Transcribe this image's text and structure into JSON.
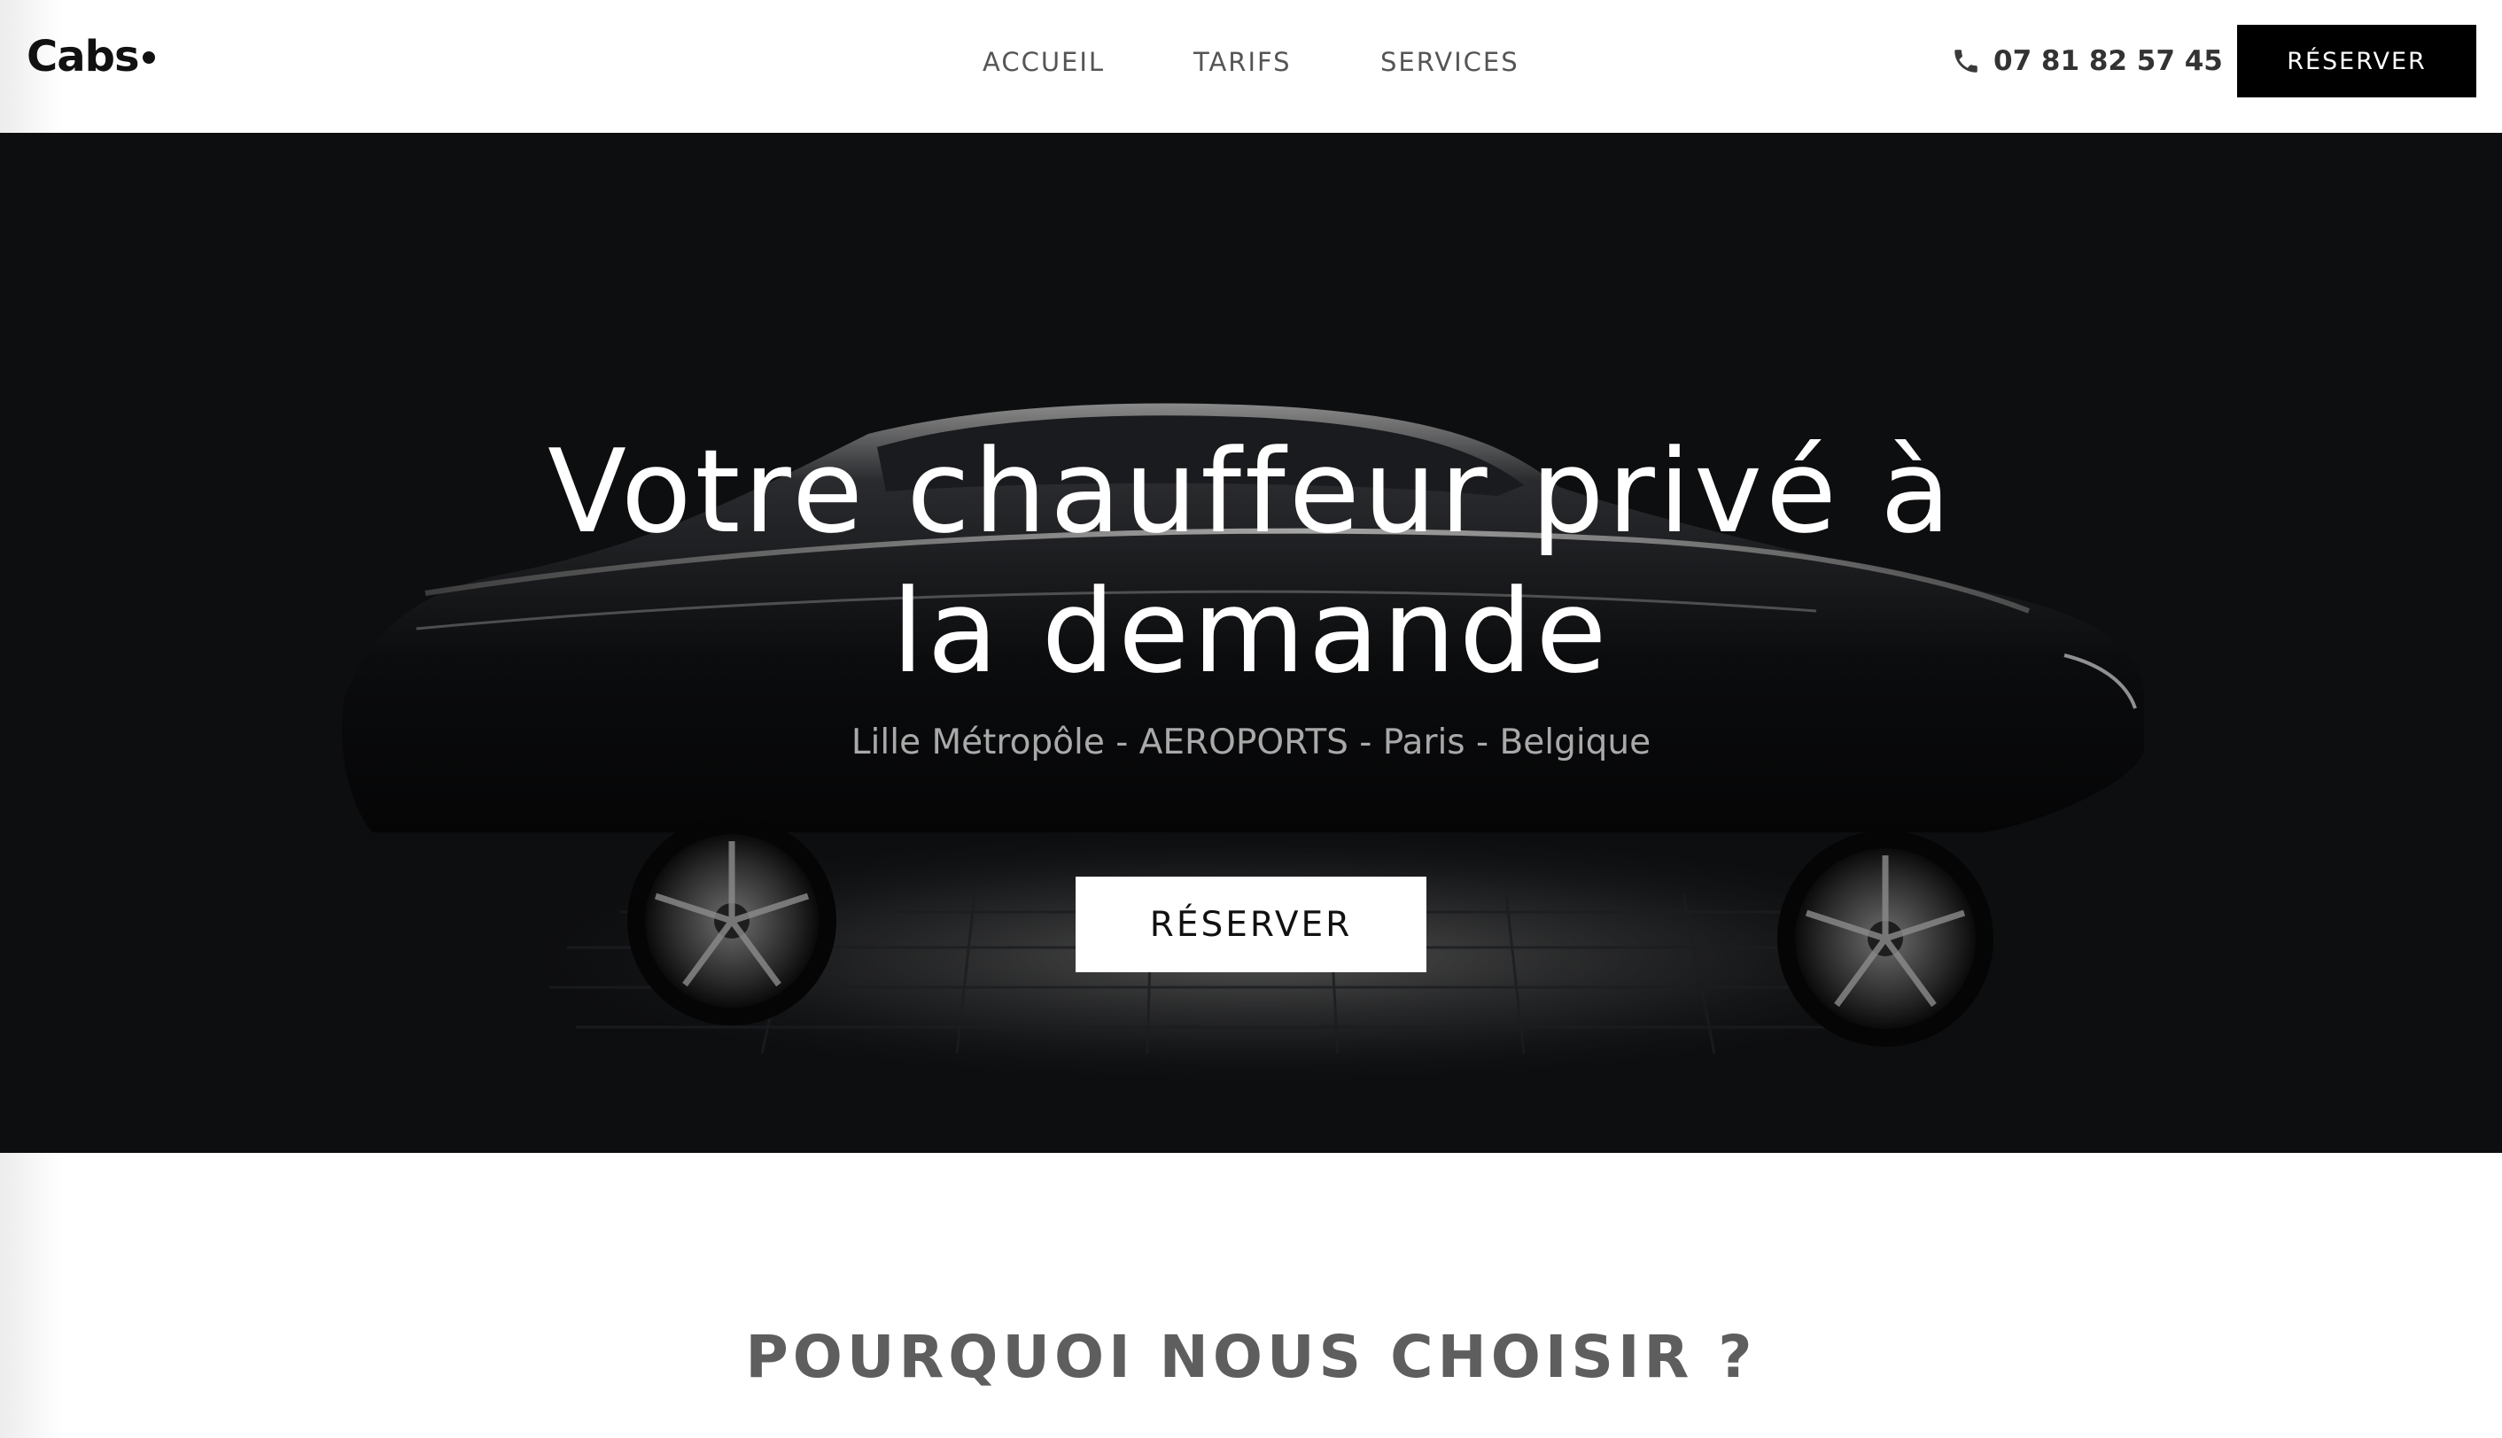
{
  "brand": {
    "logo_text": "Cabs"
  },
  "nav": {
    "items": [
      {
        "label": "ACCUEIL"
      },
      {
        "label": "TARIFS"
      },
      {
        "label": "SERVICES"
      }
    ]
  },
  "header": {
    "phone_icon": "phone-icon",
    "phone_number": "07 81 82 57 45",
    "cta_label": "RÉSERVER"
  },
  "hero": {
    "title_line1": "Votre chauffeur privé à",
    "title_line2": "la demande",
    "subtitle": "Lille Métropôle - AEROPORTS - Paris - Belgique",
    "cta_label": "RÉSERVER",
    "background_color": "#0d0e10"
  },
  "section": {
    "title": "POURQUOI NOUS CHOISIR ?"
  },
  "colors": {
    "primary_button": "#000000",
    "hero_button": "#ffffff",
    "nav_text": "#555555",
    "section_title": "#5e5e5e"
  }
}
